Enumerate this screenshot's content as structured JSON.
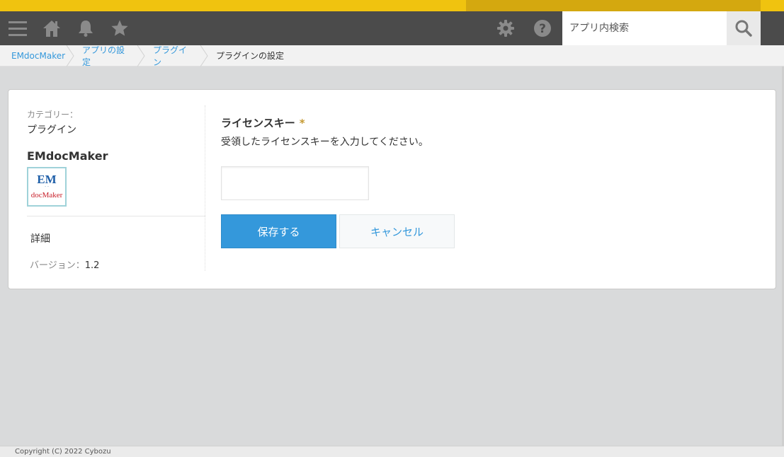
{
  "header": {
    "search_placeholder": "アプリ内検索",
    "icons": [
      "menu-icon",
      "home-icon",
      "bell-icon",
      "star-icon",
      "gear-icon",
      "help-icon",
      "search-icon"
    ]
  },
  "breadcrumb": {
    "items": [
      "EMdocMaker",
      "アプリの設定",
      "プラグイン",
      "プラグインの設定"
    ]
  },
  "plugin": {
    "category_label": "カテゴリー：",
    "category_value": "プラグイン",
    "name": "EMdocMaker",
    "logo_top": "EM",
    "logo_bottom": "docMaker",
    "detail_link": "詳細",
    "version_label": "バージョン：",
    "version_value": "1.2"
  },
  "form": {
    "field_title": "ライセンスキー",
    "required_mark": "*",
    "field_description": "受領したライセンスキーを入力してください。",
    "license_value": "",
    "save_label": "保存する",
    "cancel_label": "キャンセル"
  },
  "footer": {
    "copyright": "Copyright (C) 2022 Cybozu"
  },
  "colors": {
    "accent": "#3498db",
    "header_bg": "#4b4b4b",
    "top_stripe": "#f0c30f",
    "required": "#c59a33"
  }
}
